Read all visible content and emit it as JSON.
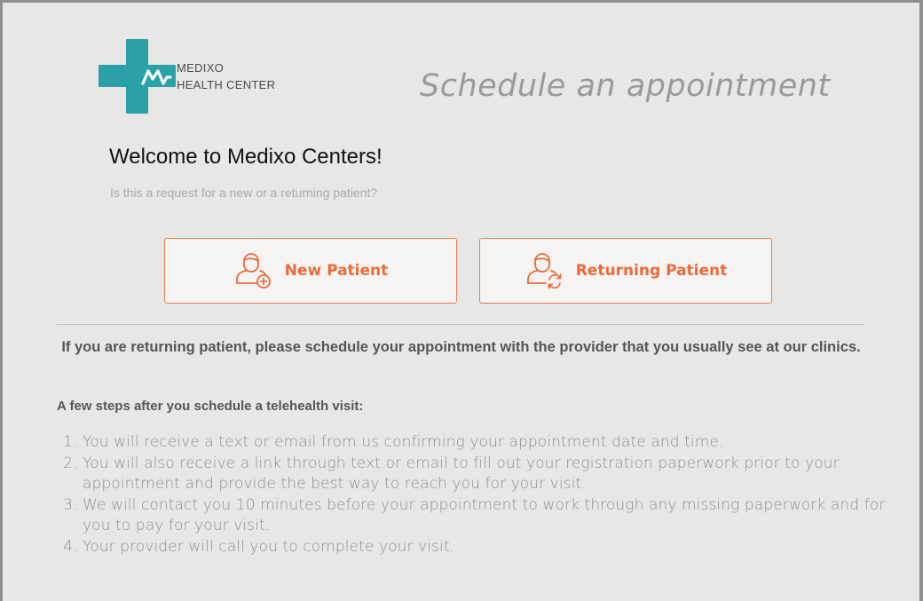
{
  "brand": {
    "line1": "MEDIXO",
    "line2": "HEALTH CENTER",
    "logo_color": "#2aa1a6",
    "logo_icon": "medical-cross-logo"
  },
  "page": {
    "heading": "Schedule an appointment",
    "welcome": "Welcome to Medixo Centers!",
    "question": "Is this a request for a new or a returning patient?"
  },
  "choices": {
    "new_patient": {
      "label": "New Patient",
      "icon": "user-add-icon"
    },
    "returning_patient": {
      "label": "Returning Patient",
      "icon": "user-refresh-icon"
    },
    "accent_color": "#ec6a39"
  },
  "returning_note": "If you are returning patient, please schedule your appointment with the  provider that you usually see at our clinics.",
  "steps": {
    "heading": "A few steps after you schedule a telehealth visit:",
    "items": [
      "You will receive a text or email from us confirming your appointment date and time.",
      "You will also receive a link through text or email to fill out your registration paperwork prior to your appointment and provide the best way to reach you for your visit.",
      "We will contact you 10 minutes before your appointment to work through any missing paperwork and for you to pay for your visit.",
      "Your provider will call you to complete your visit."
    ]
  }
}
